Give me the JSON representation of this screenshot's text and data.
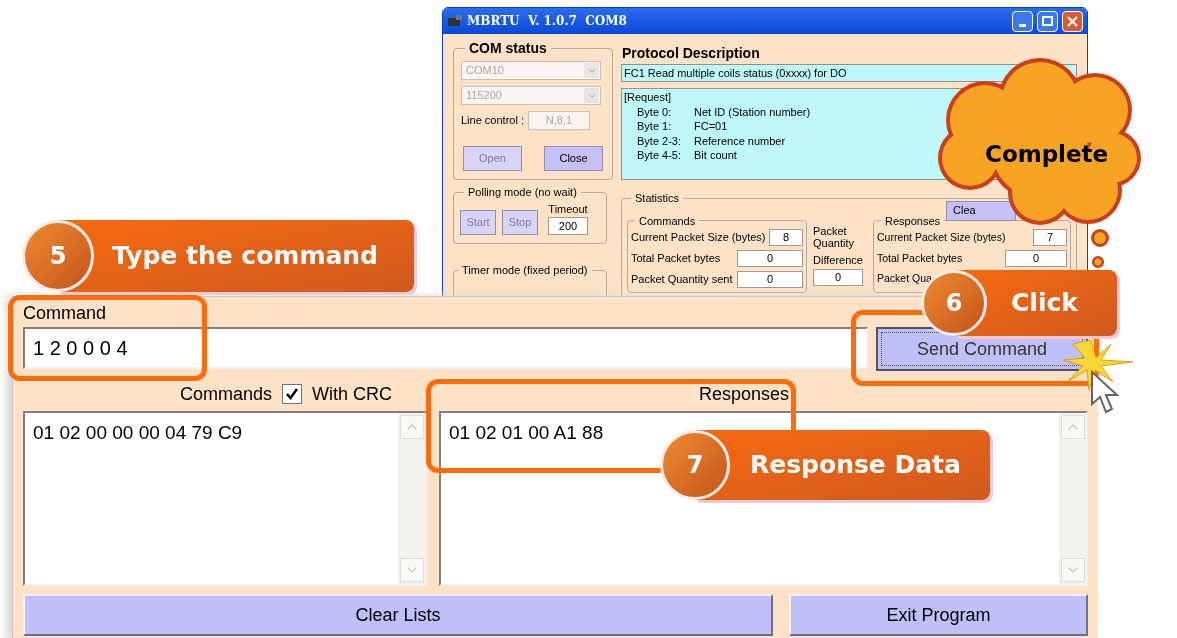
{
  "window": {
    "title": "MBRTU  V. 1.0.7  COM8"
  },
  "com_status": {
    "title": "COM status",
    "port": "COM10",
    "baud": "115200",
    "line_control_label": "Line control :",
    "line_control": "N,8,1",
    "buttons": [
      {
        "label": "Open",
        "disabled": true
      },
      {
        "label": "Close",
        "disabled": false
      }
    ]
  },
  "polling_mode": {
    "title": "Polling mode (no wait)",
    "buttons": [
      {
        "label": "Start",
        "disabled": true
      },
      {
        "label": "Stop",
        "disabled": true
      }
    ],
    "timeout_label": "Timeout",
    "timeout": "200"
  },
  "timer_mode": {
    "title": "Timer mode (fixed period)"
  },
  "protocol": {
    "title": "Protocol Description",
    "function": "FC1  Read multiple coils status (0xxxx)  for DO",
    "heading": "[Request]",
    "lines": [
      {
        "label": "Byte 0:",
        "value": "Net ID (Station number)"
      },
      {
        "label": "Byte 1:",
        "value": "FC=01"
      },
      {
        "label": "Byte 2-3:",
        "value": "Reference number"
      },
      {
        "label": "Byte 4-5:",
        "value": "Bit count"
      }
    ]
  },
  "statistics": {
    "title": "Statistics",
    "clear_button": "Clea",
    "commands": {
      "title": "Commands",
      "rows": [
        {
          "label": "Current Packet Size (bytes)",
          "value": "8"
        },
        {
          "label": "Total Packet bytes",
          "value": "0"
        },
        {
          "label": "Packet Quantity sent",
          "value": "0"
        }
      ]
    },
    "packet": {
      "title_lines": [
        "Packet",
        "Quantity"
      ],
      "label": "Difference",
      "value": "0"
    },
    "responses": {
      "title": "Responses",
      "rows": [
        {
          "label": "Current Packet Size (bytes)",
          "value": "7"
        },
        {
          "label": "Total Packet bytes",
          "value": "0"
        },
        {
          "label": "Packet Qua"
        }
      ]
    }
  },
  "command_panel": {
    "command_label": "Command",
    "command_value": "1 2 0 0 0 4",
    "send_button": "Send Command",
    "commands_label": "Commands",
    "with_crc": {
      "label": "With CRC",
      "checked": true
    },
    "responses_label": "Responses",
    "commands_list": [
      "01 02 00 00 00 04 79 C9"
    ],
    "responses_list": [
      "01 02 01 00 A1 88"
    ],
    "clear_button": "Clear Lists",
    "exit_button": "Exit Program"
  },
  "callouts": [
    {
      "number": "5",
      "text": "Type the command"
    },
    {
      "number": "6",
      "text": "Click"
    },
    {
      "number": "7",
      "text": "Response Data"
    }
  ],
  "cloud": {
    "text": "Complete"
  }
}
